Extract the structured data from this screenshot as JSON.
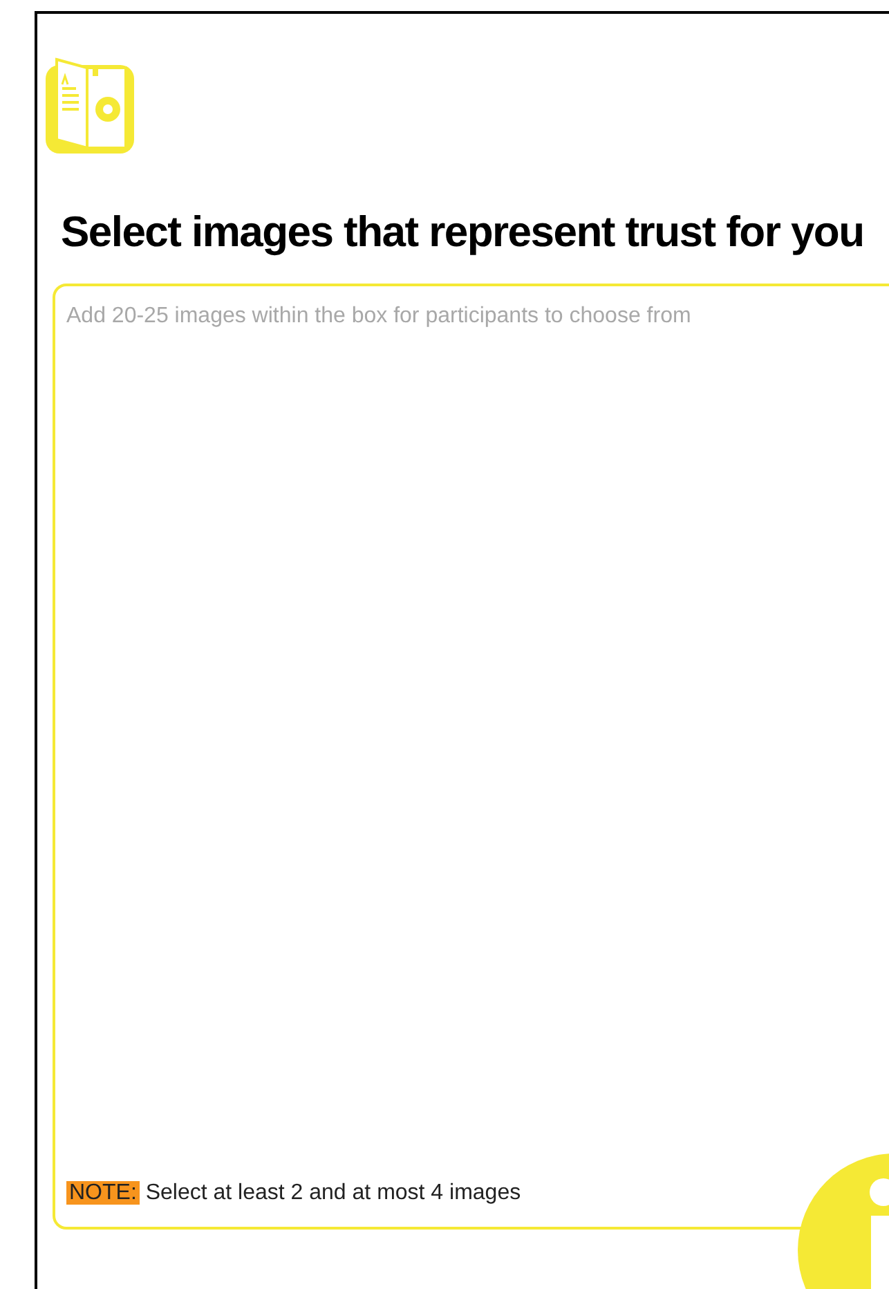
{
  "title": "Select images that represent trust for you",
  "image_box": {
    "placeholder": "Add 20-25 images within the box for participants to choose from"
  },
  "note": {
    "label": "NOTE:",
    "text": "Select at least 2 and at most 4 images"
  }
}
